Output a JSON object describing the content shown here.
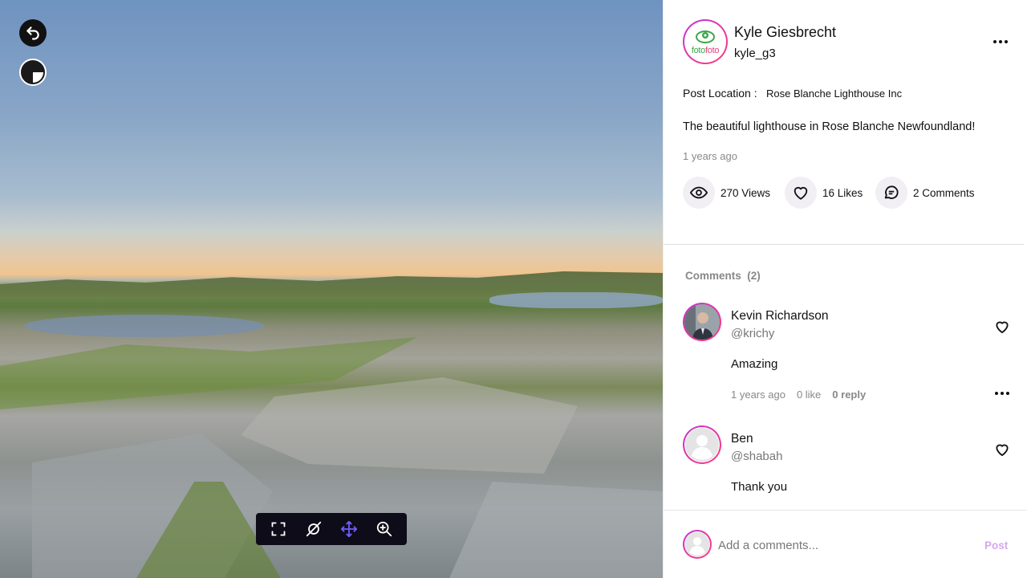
{
  "viewer": {
    "toolbar": {
      "fullscreen_icon": "fullscreen-icon",
      "orbit_icon": "orbit-icon",
      "move_icon": "move-icon",
      "zoom_icon": "zoom-in-icon",
      "active_color": "#6f5cff"
    },
    "back_icon": "back-arrow-icon",
    "compass_icon": "compass-icon"
  },
  "post": {
    "author_name": "Kyle Giesbrecht",
    "author_handle": "kyle_g3",
    "avatar_logo_text_a": "foto",
    "avatar_logo_text_b": "foto",
    "location_label": "Post Location :",
    "location_value": "Rose Blanche Lighthouse Inc",
    "caption": "The beautiful lighthouse in Rose Blanche Newfoundland!",
    "time": "1 years ago",
    "stats": {
      "views": "270 Views",
      "likes": "16 Likes",
      "comments": "2 Comments"
    }
  },
  "comments": {
    "title": "Comments",
    "count": "(2)",
    "items": [
      {
        "name": "Kevin Richardson",
        "handle": "@krichy",
        "text": "Amazing",
        "time": "1 years ago",
        "likes": "0 like",
        "reply": "0 reply"
      },
      {
        "name": "Ben",
        "handle": "@shabah",
        "text": "Thank you"
      }
    ]
  },
  "add_comment": {
    "placeholder": "Add a comments...",
    "post_label": "Post"
  },
  "colors": {
    "accent_gradient_start": "#c233d6",
    "accent_gradient_end": "#ff3b7a",
    "post_button": "#d8a6ec",
    "logo_green": "#3aa84a",
    "logo_pink": "#e5427a"
  }
}
